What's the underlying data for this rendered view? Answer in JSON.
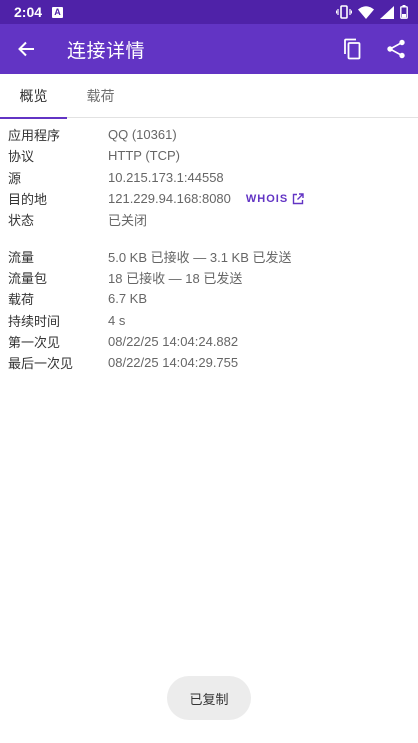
{
  "status_bar": {
    "time": "2:04",
    "notif_letter": "A"
  },
  "app_bar": {
    "title": "连接详情"
  },
  "tabs": [
    {
      "label": "概览"
    },
    {
      "label": "载荷"
    }
  ],
  "details": {
    "app_label": "应用程序",
    "app_value": "QQ (10361)",
    "protocol_label": "协议",
    "protocol_value": "HTTP (TCP)",
    "source_label": "源",
    "source_value": "10.215.173.1:44558",
    "destination_label": "目的地",
    "destination_value": "121.229.94.168:8080",
    "whois_label": "WHOIS",
    "state_label": "状态",
    "state_value": "已关闭",
    "traffic_label": "流量",
    "traffic_value": "5.0 KB 已接收 — 3.1 KB 已发送",
    "packets_label": "流量包",
    "packets_value": "18 已接收 — 18 已发送",
    "payload_label": "载荷",
    "payload_value": "6.7 KB",
    "duration_label": "持续时间",
    "duration_value": "4 s",
    "first_seen_label": "第一次见",
    "first_seen_value": "08/22/25 14:04:24.882",
    "last_seen_label": "最后一次见",
    "last_seen_value": "08/22/25 14:04:29.755"
  },
  "toast": {
    "text": "已复制"
  },
  "icons": {
    "back": "arrow-left-icon",
    "copy": "copy-icon",
    "share": "share-icon",
    "external": "external-link-icon",
    "vibrate": "vibrate-icon",
    "wifi": "wifi-icon",
    "signal": "signal-icon",
    "battery": "battery-icon"
  },
  "colors": {
    "status_bar": "#4f22a8",
    "app_bar": "#6234c4",
    "accent": "#6234c4"
  }
}
